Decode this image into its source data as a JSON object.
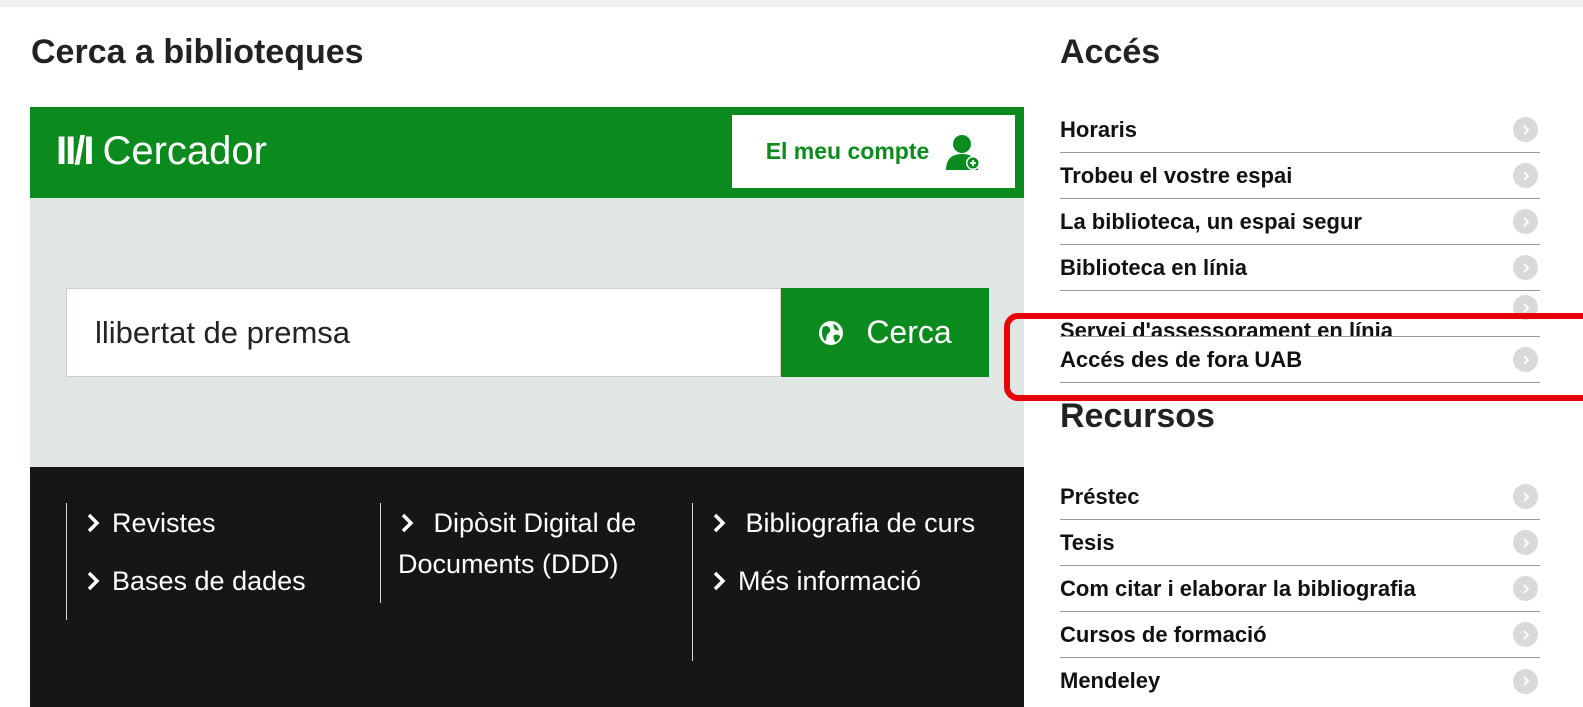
{
  "left": {
    "title": "Cerca a biblioteques",
    "brand_logo": "II/I",
    "brand_name": "Cercador",
    "account_label": "El meu compte",
    "search_value": "llibertat de premsa",
    "search_button": "Cerca",
    "links": {
      "col1": [
        "Revistes",
        "Bases de dades"
      ],
      "col2": [
        "Dipòsit Digital de Documents (DDD)"
      ],
      "col3": [
        "Bibliografia de curs",
        "Més informació"
      ]
    }
  },
  "acces": {
    "title": "Accés",
    "items": [
      "Horaris",
      "Trobeu el vostre espai",
      "La biblioteca, un espai segur",
      "Biblioteca en línia",
      "Servei d'assessorament en línia",
      "Accés des de fora UAB"
    ]
  },
  "recursos": {
    "title": "Recursos",
    "items": [
      "Préstec",
      "Tesis",
      "Com citar i elaborar la bibliografia",
      "Cursos de formació",
      "Mendeley"
    ]
  },
  "colors": {
    "brand_green": "#0b8a1e",
    "highlight_red": "#e8000b",
    "dark_footer": "#161616"
  },
  "icons": [
    "user-plus-icon",
    "globe-icon",
    "chevron-right-icon",
    "circle-arrow-icon"
  ]
}
